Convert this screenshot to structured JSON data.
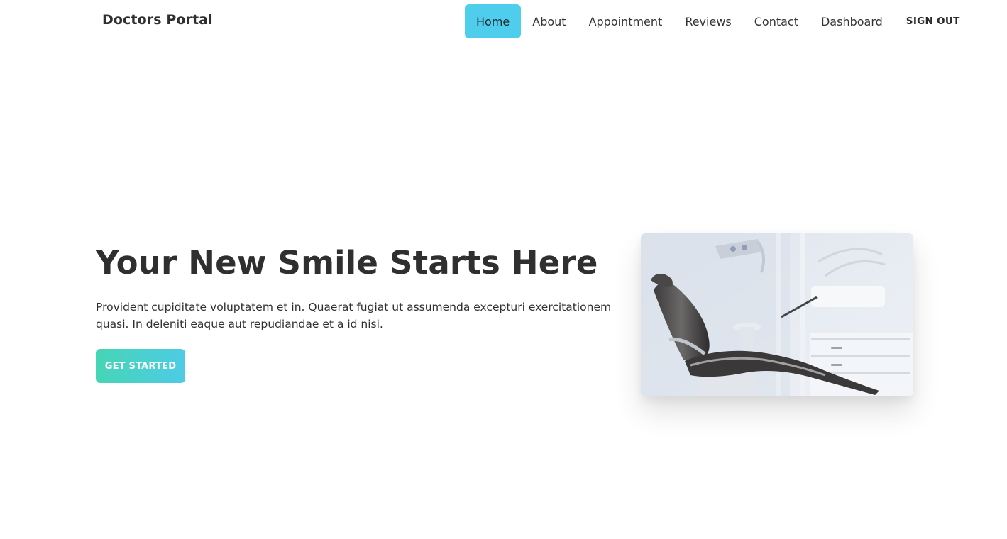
{
  "brand": {
    "name": "Doctors Portal"
  },
  "nav": {
    "items": [
      {
        "label": "Home",
        "active": true
      },
      {
        "label": "About",
        "active": false
      },
      {
        "label": "Appointment",
        "active": false
      },
      {
        "label": "Reviews",
        "active": false
      },
      {
        "label": "Contact",
        "active": false
      },
      {
        "label": "Dashboard",
        "active": false
      }
    ],
    "signout_label": "SIGN OUT"
  },
  "hero": {
    "title": "Your New Smile Starts Here",
    "description": "Provident cupiditate voluptatem et in. Quaerat fugiat ut assumenda excepturi exercitationem quasi. In deleniti eaque aut repudiandae et a id nisi.",
    "cta_label": "GET STARTED",
    "image_subject": "dental-chair-photo"
  },
  "colors": {
    "accent": "#4ecdec",
    "cta_gradient_start": "#46d5b5",
    "cta_gradient_end": "#4ecbe6",
    "text": "#2f2f2f"
  }
}
